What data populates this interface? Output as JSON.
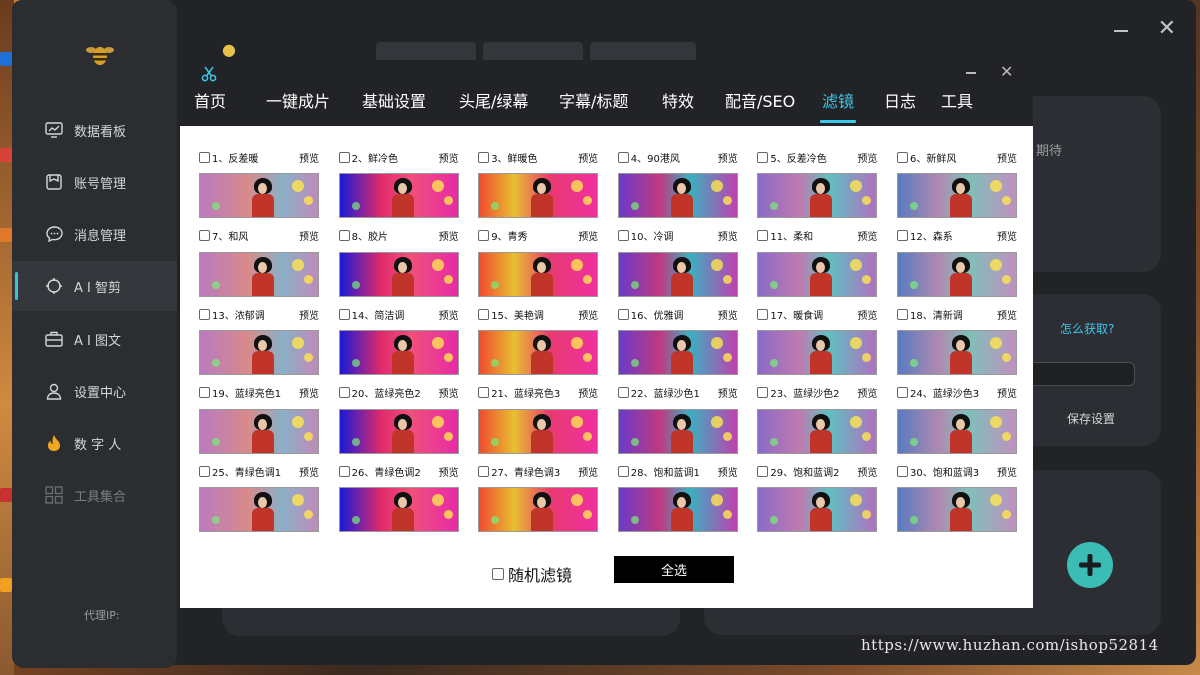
{
  "sidebar": {
    "items": [
      {
        "label": "数据看板",
        "icon": "chart-monitor-icon"
      },
      {
        "label": "账号管理",
        "icon": "account-card-icon"
      },
      {
        "label": "消息管理",
        "icon": "message-bubble-icon"
      },
      {
        "label": "A I 智剪",
        "icon": "ai-clip-icon"
      },
      {
        "label": "A I 图文",
        "icon": "briefcase-icon"
      },
      {
        "label": "设置中心",
        "icon": "settings-user-icon"
      },
      {
        "label": "数 字 人",
        "icon": "flame-icon"
      },
      {
        "label": "工具集合",
        "icon": "grid-tools-icon"
      }
    ],
    "active_index": 3,
    "agent_ip_label": "代理IP:"
  },
  "background": {
    "side_text": "期待",
    "how_to_get": "怎么获取?",
    "save_settings": "保存设置"
  },
  "dialog": {
    "tabs": [
      "首页",
      "一键成片",
      "基础设置",
      "头尾/绿幕",
      "字幕/标题",
      "特效",
      "配音/SEO",
      "滤镜",
      "日志",
      "工具"
    ],
    "active_tab": "滤镜",
    "preview_label": "预览",
    "filters": [
      "1、反差暖",
      "2、鲜冷色",
      "3、鲜暖色",
      "4、90港风",
      "5、反差冷色",
      "6、新鲜风",
      "7、和风",
      "8、胶片",
      "9、青秀",
      "10、冷调",
      "11、柔和",
      "12、森系",
      "13、浓郁调",
      "14、简洁调",
      "15、美艳调",
      "16、优雅调",
      "17、暖食调",
      "18、清新调",
      "19、蓝绿亮色1",
      "20、蓝绿亮色2",
      "21、蓝绿亮色3",
      "22、蓝绿沙色1",
      "23、蓝绿沙色2",
      "24、蓝绿沙色3",
      "25、青绿色调1",
      "26、青绿色调2",
      "27、青绿色调3",
      "28、饱和蓝调1",
      "29、饱和蓝调2",
      "30、饱和蓝调3"
    ],
    "random_filter_label": "随机滤镜",
    "select_all_label": "全选"
  },
  "watermark": "https://www.huzhan.com/ishop52814",
  "colors": {
    "accent": "#3ec7e8",
    "teal_button": "#3bbdb6",
    "app_bg": "#222326",
    "sidebar_bg": "#2b2d31"
  }
}
